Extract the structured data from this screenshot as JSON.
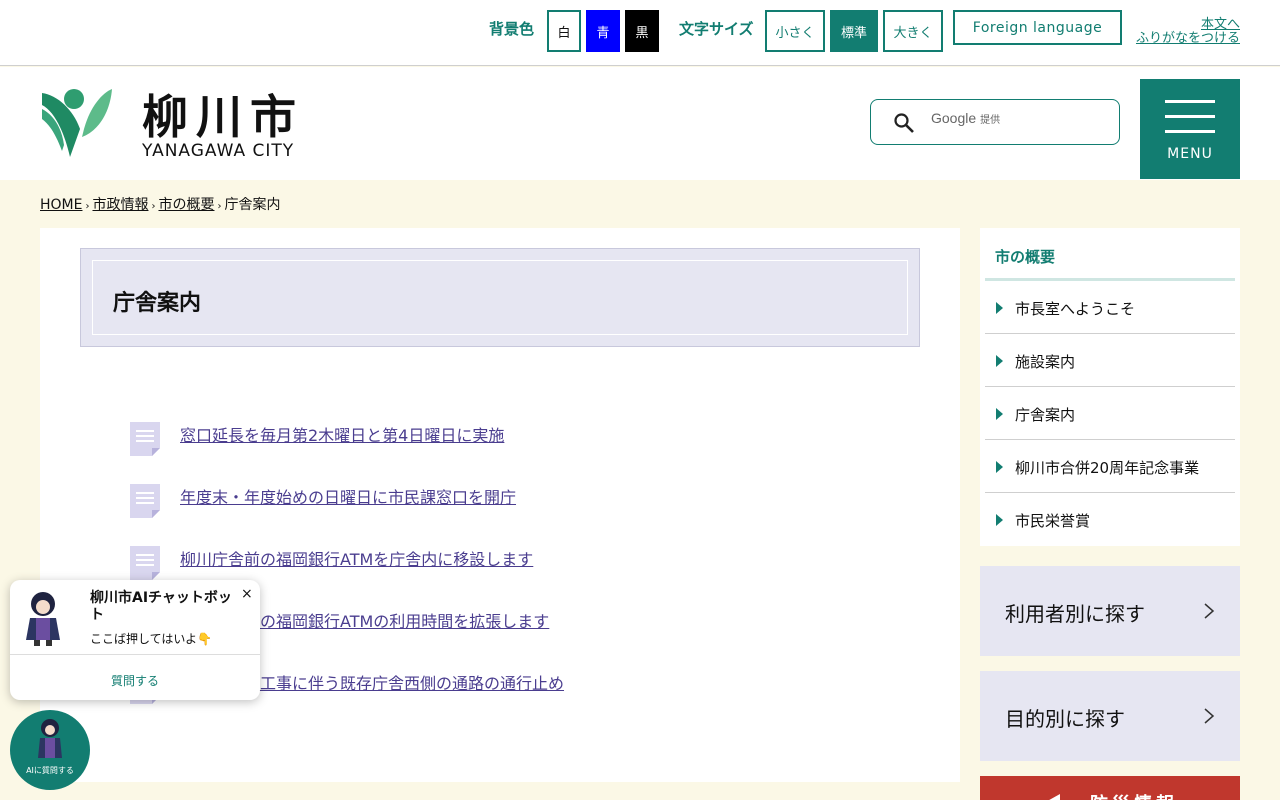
{
  "util": {
    "bg_label": "背景色",
    "bg_white": "白",
    "bg_blue": "青",
    "bg_black": "黒",
    "font_label": "文字サイズ",
    "font_small": "小さく",
    "font_standard": "標準",
    "font_large": "大きく",
    "foreign": "Foreign language",
    "skip_main": "本文へ",
    "furigana": "ふりがなをつける"
  },
  "header": {
    "logo_name": "柳川市",
    "logo_en": "YANAGAWA CITY",
    "search_placeholder": "Google",
    "search_sub": "提供",
    "menu_label": "MENU"
  },
  "breadcrumb": [
    "HOME",
    "市政情報",
    "市の概要",
    "庁舎案内"
  ],
  "main": {
    "title": "庁舎案内",
    "links": [
      "窓口延長を毎月第2木曜日と第4日曜日に実施",
      "年度末・年度始めの日曜日に市民課窓口を開庁",
      "柳川庁舎前の福岡銀行ATMを庁舎内に移設します",
      "柳川庁舎前の福岡銀行ATMの利用時間を拡張します",
      "新庁舎建築工事に伴う既存庁舎西側の通路の通行止め"
    ]
  },
  "sidebar": {
    "title": "市の概要",
    "items": [
      "市長室へようこそ",
      "施設案内",
      "庁舎案内",
      "柳川市合併20周年記念事業",
      "市民栄誉賞"
    ],
    "by_user": "利用者別に探す",
    "by_purpose": "目的別に探す",
    "disaster": "防災情報"
  },
  "chat": {
    "title": "柳川市AIチャットボット",
    "message": "ここば押してはいよ👇",
    "close": "×",
    "ask": "質問する",
    "fab_label": "AIに質問する"
  },
  "colors": {
    "accent": "#127d71",
    "title_bg": "#e6e6f2",
    "page_bg": "#fbf8e6",
    "link": "#4a3d8f",
    "disaster": "#c0372d"
  }
}
